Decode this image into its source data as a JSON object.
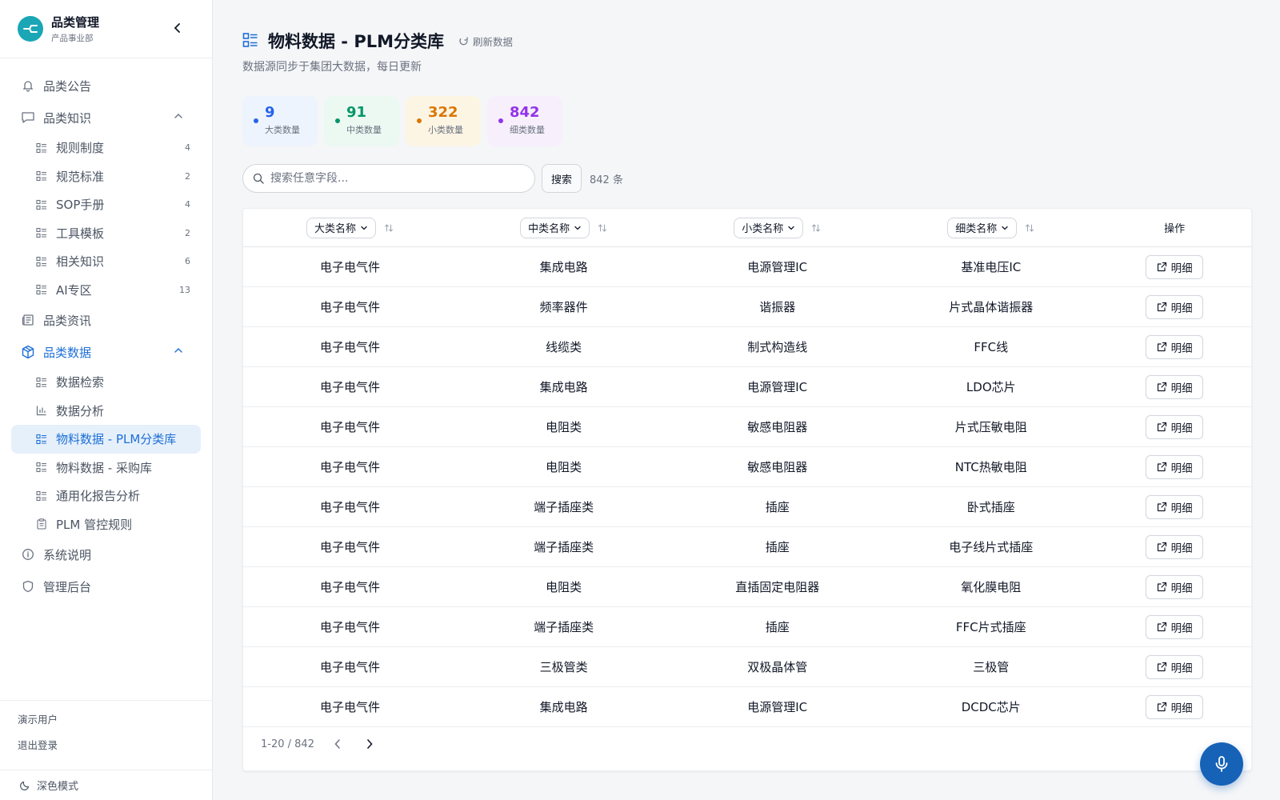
{
  "brand": {
    "title": "品类管理",
    "subtitle": "产品事业部"
  },
  "nav": {
    "announcements": "品类公告",
    "knowledge": {
      "label": "品类知识",
      "items": [
        {
          "label": "规则制度",
          "count": "4"
        },
        {
          "label": "规范标准",
          "count": "2"
        },
        {
          "label": "SOP手册",
          "count": "4"
        },
        {
          "label": "工具模板",
          "count": "2"
        },
        {
          "label": "相关知识",
          "count": "6"
        },
        {
          "label": "AI专区",
          "count": "13"
        }
      ]
    },
    "news": "品类资讯",
    "data": {
      "label": "品类数据",
      "items": [
        {
          "label": "数据检索"
        },
        {
          "label": "数据分析"
        },
        {
          "label": "物料数据 - PLM分类库"
        },
        {
          "label": "物料数据 - 采购库"
        },
        {
          "label": "通用化报告分析"
        },
        {
          "label": "PLM 管控规则"
        }
      ]
    },
    "system_info": "系统说明",
    "admin": "管理后台"
  },
  "footer": {
    "user": "演示用户",
    "logout": "退出登录",
    "dark_mode": "深色模式"
  },
  "page": {
    "title": "物料数据 - PLM分类库",
    "refresh": "刷新数据",
    "subtitle": "数据源同步于集团大数据，每日更新"
  },
  "stats": [
    {
      "value": "9",
      "label": "大类数量",
      "color": "#2563eb",
      "bg": "#eef4fd"
    },
    {
      "value": "91",
      "label": "中类数量",
      "color": "#059669",
      "bg": "#ecf8f2"
    },
    {
      "value": "322",
      "label": "小类数量",
      "color": "#d97706",
      "bg": "#fdf5e4"
    },
    {
      "value": "842",
      "label": "细类数量",
      "color": "#9333ea",
      "bg": "#f7f0fc"
    }
  ],
  "search": {
    "placeholder": "搜索任意字段...",
    "button": "搜索",
    "total": "842 条"
  },
  "table": {
    "headers": [
      "大类名称",
      "中类名称",
      "小类名称",
      "细类名称",
      "操作"
    ],
    "detail_label": "明细",
    "rows": [
      [
        "电子电气件",
        "集成电路",
        "电源管理IC",
        "基准电压IC"
      ],
      [
        "电子电气件",
        "频率器件",
        "谐振器",
        "片式晶体谐振器"
      ],
      [
        "电子电气件",
        "线缆类",
        "制式构造线",
        "FFC线"
      ],
      [
        "电子电气件",
        "集成电路",
        "电源管理IC",
        "LDO芯片"
      ],
      [
        "电子电气件",
        "电阻类",
        "敏感电阻器",
        "片式压敏电阻"
      ],
      [
        "电子电气件",
        "电阻类",
        "敏感电阻器",
        "NTC热敏电阻"
      ],
      [
        "电子电气件",
        "端子插座类",
        "插座",
        "卧式插座"
      ],
      [
        "电子电气件",
        "端子插座类",
        "插座",
        "电子线片式插座"
      ],
      [
        "电子电气件",
        "电阻类",
        "直插固定电阻器",
        "氧化膜电阻"
      ],
      [
        "电子电气件",
        "端子插座类",
        "插座",
        "FFC片式插座"
      ],
      [
        "电子电气件",
        "三极管类",
        "双极晶体管",
        "三极管"
      ],
      [
        "电子电气件",
        "集成电路",
        "电源管理IC",
        "DCDC芯片"
      ]
    ]
  },
  "pager": {
    "range": "1-20 / 842"
  },
  "colors": {
    "accent": "#1d6fd6",
    "brand": "#1ba6b6",
    "mic": "#1662b7"
  }
}
